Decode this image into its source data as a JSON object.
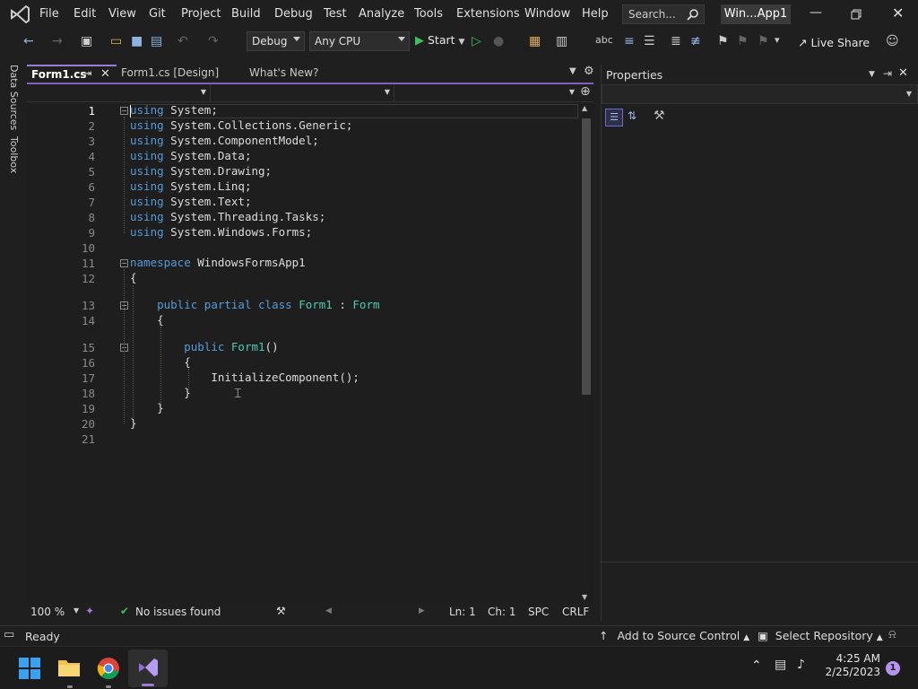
{
  "app": {
    "window_title": "Win...App1",
    "menu": [
      "File",
      "Edit",
      "View",
      "Git",
      "Project",
      "Build",
      "Debug",
      "Test",
      "Analyze",
      "Tools",
      "Extensions",
      "Window",
      "Help"
    ],
    "search_placeholder": "Search..."
  },
  "toolbar": {
    "config": "Debug",
    "platform": "Any CPU",
    "start_label": "Start",
    "live_share_label": "Live Share"
  },
  "side_rail": {
    "data_sources": "Data Sources",
    "toolbox": "Toolbox"
  },
  "editor": {
    "tabs": [
      {
        "label": "Form1.cs",
        "active": true
      },
      {
        "label": "Form1.cs [Design]",
        "active": false
      },
      {
        "label": "What's New?",
        "active": false
      }
    ],
    "lines": [
      {
        "n": "1",
        "text": "using System;"
      },
      {
        "n": "2",
        "text": "using System.Collections.Generic;"
      },
      {
        "n": "3",
        "text": "using System.ComponentModel;"
      },
      {
        "n": "4",
        "text": "using System.Data;"
      },
      {
        "n": "5",
        "text": "using System.Drawing;"
      },
      {
        "n": "6",
        "text": "using System.Linq;"
      },
      {
        "n": "7",
        "text": "using System.Text;"
      },
      {
        "n": "8",
        "text": "using System.Threading.Tasks;"
      },
      {
        "n": "9",
        "text": "using System.Windows.Forms;"
      },
      {
        "n": "10",
        "text": ""
      },
      {
        "n": "11",
        "text": "namespace WindowsFormsApp1"
      },
      {
        "n": "12",
        "text": "{"
      },
      {
        "n": "13",
        "text": "    public partial class Form1 : Form"
      },
      {
        "n": "14",
        "text": "    {"
      },
      {
        "n": "15",
        "text": "        public Form1()"
      },
      {
        "n": "16",
        "text": "        {"
      },
      {
        "n": "17",
        "text": "            InitializeComponent();"
      },
      {
        "n": "18",
        "text": "        }"
      },
      {
        "n": "19",
        "text": "    }"
      },
      {
        "n": "20",
        "text": "}"
      },
      {
        "n": "21",
        "text": ""
      }
    ],
    "status": {
      "zoom": "100 %",
      "issues": "No issues found",
      "line": "Ln: 1",
      "col": "Ch: 1",
      "whitespace": "SPC",
      "eol": "CRLF"
    }
  },
  "properties": {
    "title": "Properties"
  },
  "statusbar": {
    "ready": "Ready",
    "source_control": "Add to Source Control",
    "repository": "Select Repository",
    "notifications": "1"
  },
  "taskbar": {
    "time": "4:25 AM",
    "date": "2/25/2023",
    "badge": "1"
  }
}
